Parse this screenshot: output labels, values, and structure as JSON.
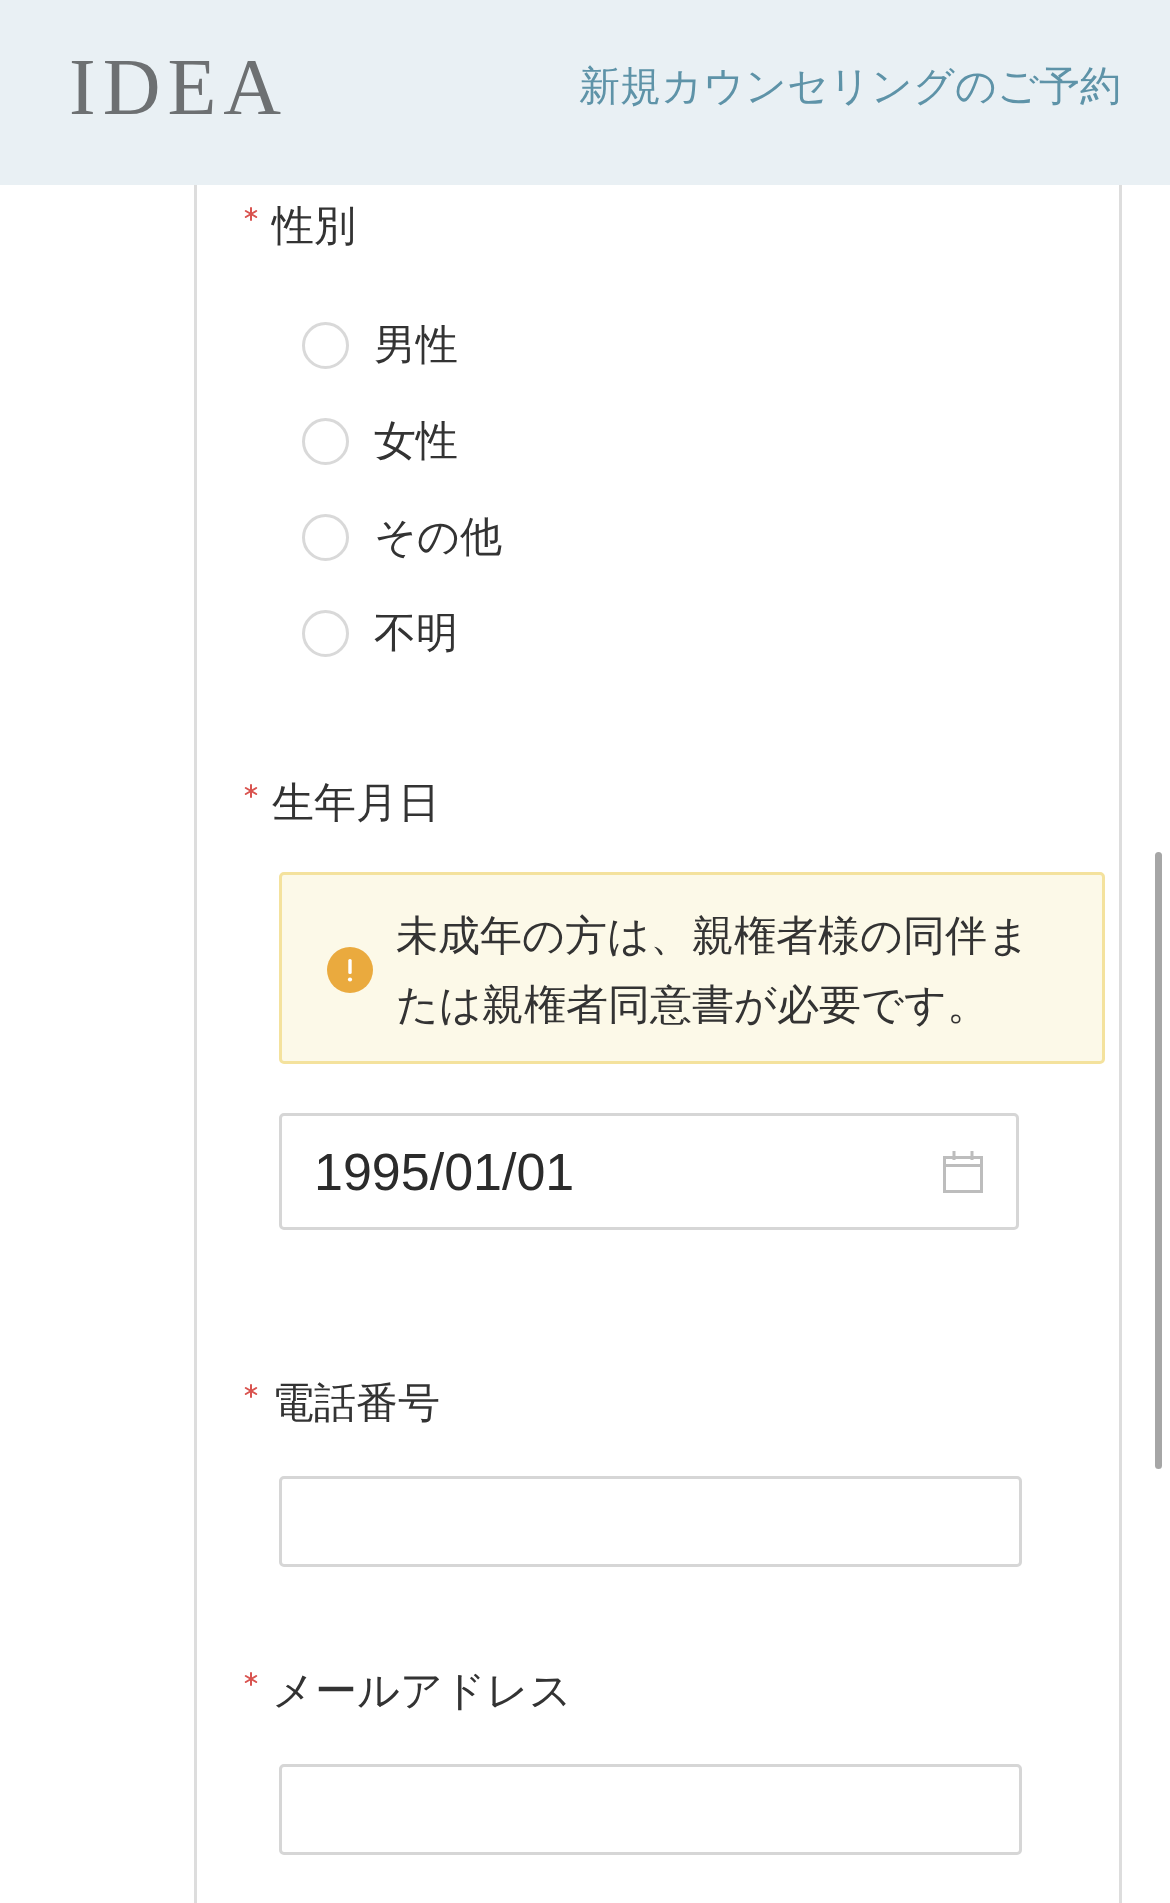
{
  "header": {
    "logo": "IDEA",
    "title": "新規カウンセリングのご予約"
  },
  "fields": [
    {
      "kind": "radio",
      "label": "性別",
      "required": true,
      "options": [
        {
          "label": "男性",
          "selected": false
        },
        {
          "label": "女性",
          "selected": false
        },
        {
          "label": "その他",
          "selected": false
        },
        {
          "label": "不明",
          "selected": false
        }
      ]
    },
    {
      "kind": "date",
      "label": "生年月日",
      "required": true,
      "notice": {
        "text": "未成年の方は、親権者様の同伴または親権者同意書が必要です。"
      },
      "value": "1995/01/01"
    },
    {
      "kind": "text",
      "label": "電話番号",
      "required": true
    },
    {
      "kind": "text",
      "label": "メールアドレス",
      "required": true
    }
  ]
}
